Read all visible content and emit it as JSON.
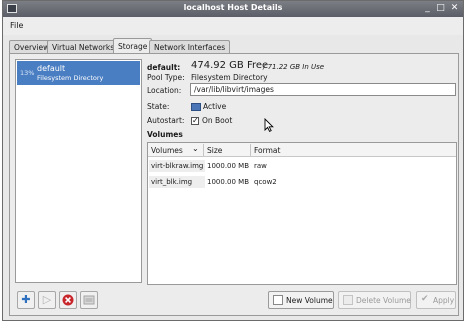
{
  "window": {
    "title": "localhost Host Details"
  },
  "menubar": {
    "file": "File"
  },
  "tabs": [
    {
      "label": "Overview"
    },
    {
      "label": "Virtual Networks"
    },
    {
      "label": "Storage"
    },
    {
      "label": "Network Interfaces"
    }
  ],
  "pools": [
    {
      "percent": "13%",
      "name": "default",
      "type": "Filesystem Directory"
    }
  ],
  "details": {
    "name_label": "default:",
    "free": "474.92 GB Free",
    "in_use": "/ 71.22 GB In Use",
    "pool_type_label": "Pool Type:",
    "pool_type": "Filesystem Directory",
    "location_label": "Location:",
    "location": "/var/lib/libvirt/images",
    "state_label": "State:",
    "state": "Active",
    "autostart_label": "Autostart:",
    "autostart": "On Boot",
    "volumes_label": "Volumes"
  },
  "volumes": {
    "headers": [
      "Volumes",
      "Size",
      "Format"
    ],
    "rows": [
      {
        "name": "virt-blkraw.img",
        "size": "1000.00 MB",
        "format": "raw"
      },
      {
        "name": "virt_blk.img",
        "size": "1000.00 MB",
        "format": "qcow2"
      }
    ]
  },
  "buttons": {
    "new_volume": "New Volume",
    "delete_volume": "Delete Volume",
    "apply": "Apply"
  },
  "icons": {
    "add_pool": "plus-icon",
    "start_pool": "play-icon",
    "stop_pool": "stop-icon",
    "delete_pool": "delete-icon"
  }
}
